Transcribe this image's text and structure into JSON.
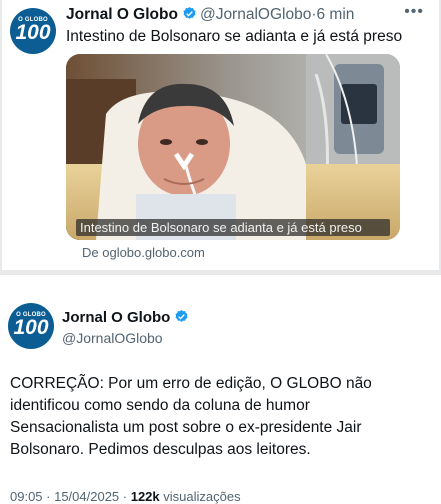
{
  "tweet1": {
    "avatar": {
      "top": "O GLOBO",
      "number": "100"
    },
    "name": "Jornal O Globo",
    "handle": "@JornalOGlobo",
    "separator": "·",
    "time": "6 min",
    "text": "Intestino de Bolsonaro se adianta e já está preso",
    "media_caption": "Intestino de Bolsonaro se adianta e já está preso",
    "link_source": "De oglobo.globo.com"
  },
  "tweet2": {
    "avatar": {
      "top": "O GLOBO",
      "number": "100"
    },
    "name": "Jornal O Globo",
    "handle": "@JornalOGlobo",
    "body_lines": [
      "CORREÇÃO: Por um erro de edição, O GLOBO não",
      "identificou como sendo da coluna de humor",
      "Sensacionalista um post sobre o ex-presidente Jair",
      "Bolsonaro. Pedimos desculpas aos leitores."
    ],
    "meta_time": "09:05 · 15/04/2025 ·",
    "meta_views": "122k",
    "meta_views_label": "visualizações"
  },
  "colors": {
    "avatar_bg": "#0b5d94",
    "verified": "#1d9bf0",
    "secondary_text": "#536471",
    "band": "#e7e9ea"
  },
  "icons": [
    "verified-badge-icon",
    "more-options-icon"
  ]
}
